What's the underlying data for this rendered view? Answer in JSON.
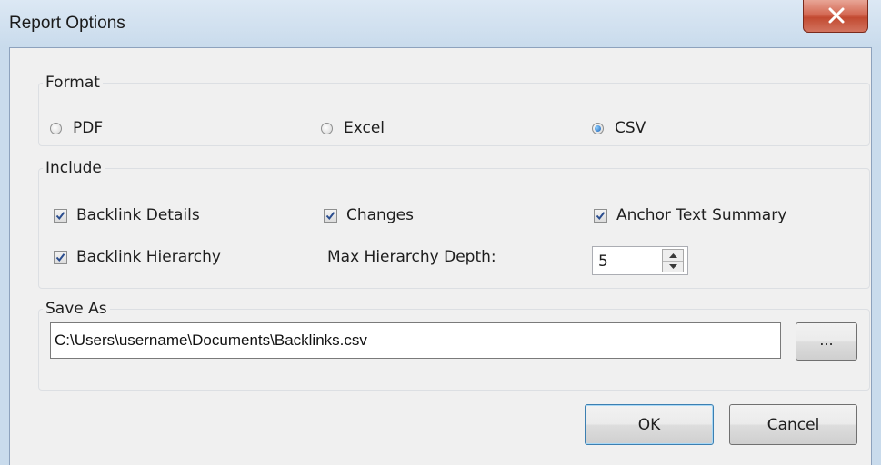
{
  "window": {
    "title": "Report Options",
    "close_label": "close"
  },
  "format": {
    "legend": "Format",
    "options": [
      {
        "label": "PDF",
        "checked": false
      },
      {
        "label": "Excel",
        "checked": false
      },
      {
        "label": "CSV",
        "checked": true
      }
    ]
  },
  "include": {
    "legend": "Include",
    "backlink_details": {
      "label": "Backlink Details",
      "checked": true
    },
    "changes": {
      "label": "Changes",
      "checked": true
    },
    "anchor_text_summary": {
      "label": "Anchor Text Summary",
      "checked": true
    },
    "backlink_hierarchy": {
      "label": "Backlink Hierarchy",
      "checked": true
    },
    "max_depth_label": "Max Hierarchy Depth:",
    "max_depth_value": "5"
  },
  "save_as": {
    "legend": "Save As",
    "path": "C:\\Users\\username\\Documents\\Backlinks.csv",
    "browse_label": "..."
  },
  "buttons": {
    "ok": "OK",
    "cancel": "Cancel"
  },
  "colors": {
    "titlebar": "#c9dbec",
    "client": "#f0f0f0",
    "close": "#c24a31",
    "default_button_border": "#3c7fb1"
  }
}
